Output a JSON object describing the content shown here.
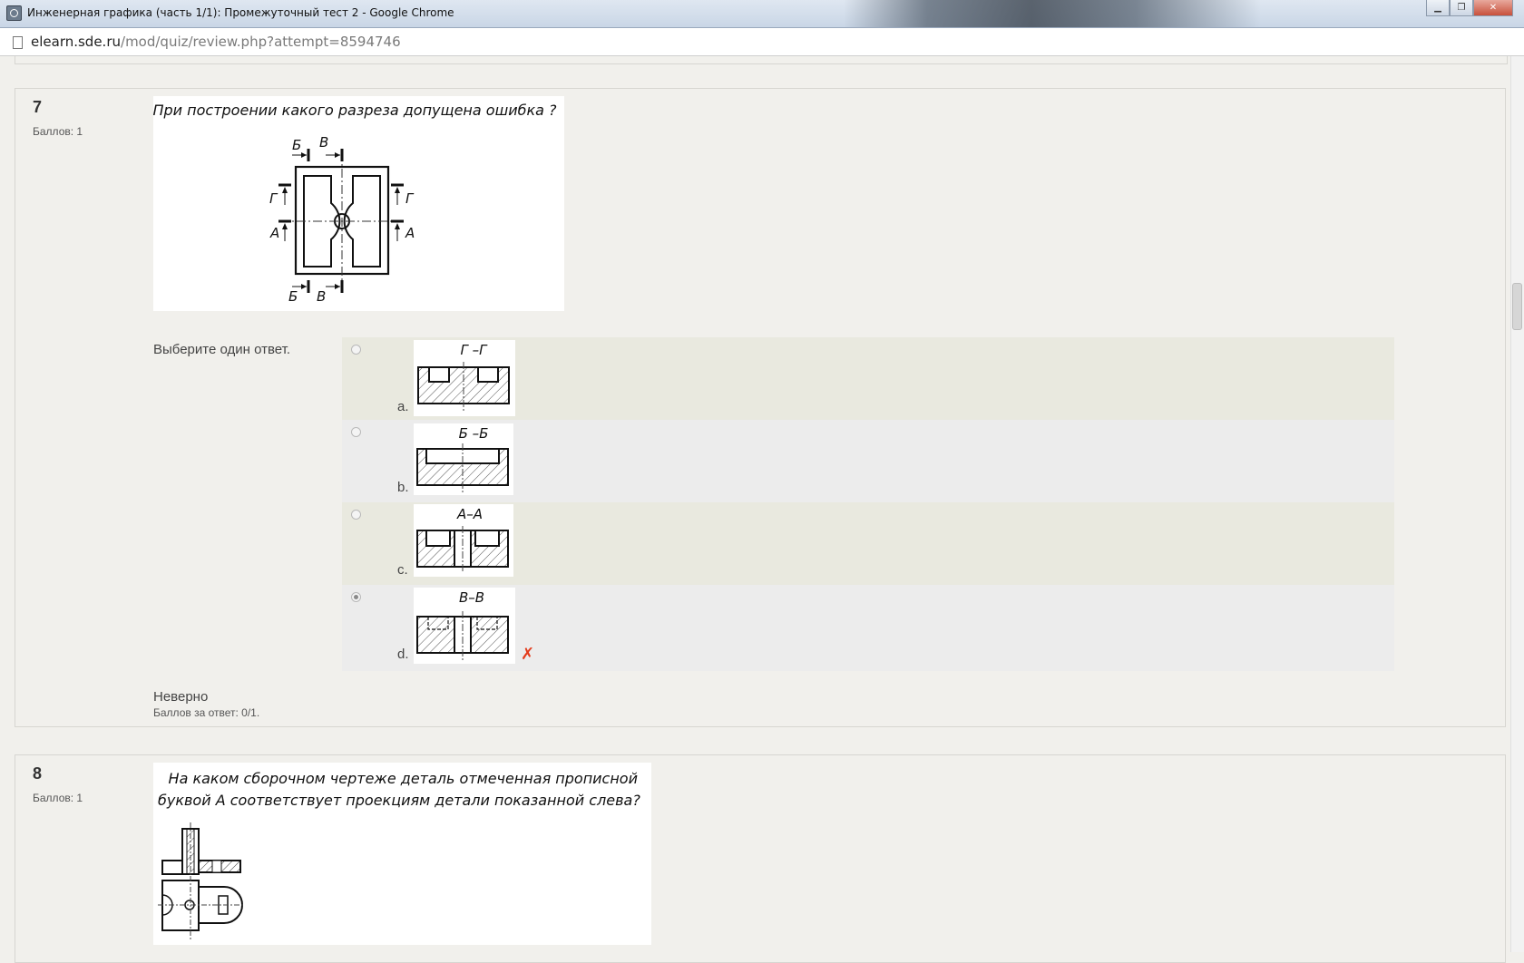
{
  "browser": {
    "window_title": "Инженерная графика (часть 1/1): Промежуточный тест 2 - Google Chrome",
    "url_host": "elearn.sde.ru",
    "url_path": "/mod/quiz/review.php?attempt=8594746",
    "window_buttons": [
      "minimize",
      "restore",
      "close"
    ]
  },
  "question7": {
    "number": "7",
    "mark": "Баллов: 1",
    "question_image_text": "При построении какого разреза допущена ошибка ?",
    "drawing_labels": {
      "b_top": "Б",
      "v_top": "В",
      "g_left": "Г",
      "a_left": "А",
      "g_right": "Г",
      "a_right": "А",
      "b_bottom": "Б",
      "v_bottom": "В"
    },
    "prompt": "Выберите один ответ.",
    "options": [
      {
        "letter": "a.",
        "section_label": "Г –Г",
        "selected": false
      },
      {
        "letter": "b.",
        "section_label": "Б –Б",
        "selected": false
      },
      {
        "letter": "c.",
        "section_label": "А–А",
        "selected": false
      },
      {
        "letter": "d.",
        "section_label": "В–В",
        "selected": true
      }
    ],
    "incorrect_icon": "✗",
    "outcome": "Неверно",
    "outcome_mark": "Баллов за ответ: 0/1."
  },
  "question8": {
    "number": "8",
    "mark": "Баллов: 1",
    "question_image_text_line1": "На каком сборочном чертеже деталь отмеченная прописной",
    "question_image_text_line2": "буквой А соответствует проекциям детали показанной слева?"
  },
  "colors": {
    "page_bg": "#f1f0ec",
    "option_odd_bg": "#e9e9df",
    "option_even_bg": "#ececec",
    "incorrect": "#e33b1b"
  }
}
